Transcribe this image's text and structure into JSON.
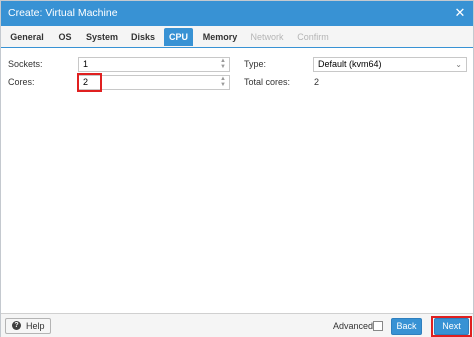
{
  "window": {
    "title": "Create: Virtual Machine",
    "close_glyph": "✕"
  },
  "tabs": [
    {
      "label": "General",
      "state": "normal"
    },
    {
      "label": "OS",
      "state": "normal"
    },
    {
      "label": "System",
      "state": "normal"
    },
    {
      "label": "Disks",
      "state": "normal"
    },
    {
      "label": "CPU",
      "state": "active"
    },
    {
      "label": "Memory",
      "state": "normal"
    },
    {
      "label": "Network",
      "state": "disabled"
    },
    {
      "label": "Confirm",
      "state": "disabled"
    }
  ],
  "form": {
    "sockets": {
      "label": "Sockets:",
      "value": "1"
    },
    "cores": {
      "label": "Cores:",
      "value": "2"
    },
    "type": {
      "label": "Type:",
      "value": "Default (kvm64)"
    },
    "total_cores": {
      "label": "Total cores:",
      "value": "2"
    }
  },
  "footer": {
    "help_label": "Help",
    "help_icon_glyph": "?",
    "advanced_label": "Advanced",
    "advanced_checked": false,
    "back_label": "Back",
    "next_label": "Next"
  },
  "colors": {
    "accent": "#3892d4",
    "highlight": "#e02020"
  },
  "icons": {
    "close": "close-icon",
    "help": "help-icon",
    "spinner": "spinner-icon",
    "dropdown": "chevron-down-icon"
  }
}
